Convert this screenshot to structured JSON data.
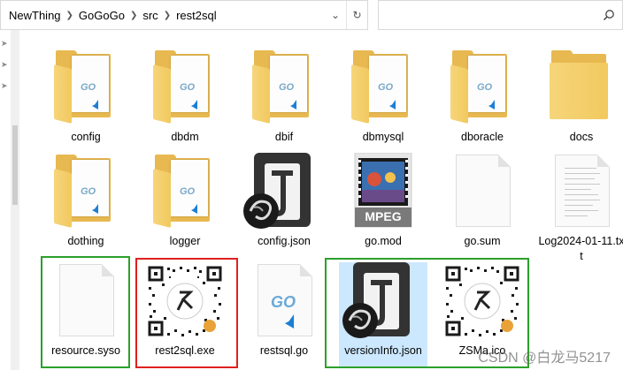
{
  "address_bar": {
    "crumbs": [
      "NewThing",
      "GoGoGo",
      "src",
      "rest2sql"
    ],
    "dropdown_icon": "chevron-down-icon",
    "refresh_icon": "refresh-icon"
  },
  "search": {
    "placeholder": "",
    "icon": "search-icon"
  },
  "files": [
    {
      "name": "config",
      "kind": "folder-go"
    },
    {
      "name": "dbdm",
      "kind": "folder-go"
    },
    {
      "name": "dbif",
      "kind": "folder-go"
    },
    {
      "name": "dbmysql",
      "kind": "folder-go"
    },
    {
      "name": "dboracle",
      "kind": "folder-go"
    },
    {
      "name": "docs",
      "kind": "folder"
    },
    {
      "name": "dothing",
      "kind": "folder-go"
    },
    {
      "name": "logger",
      "kind": "folder-go"
    },
    {
      "name": "config.json",
      "kind": "json-app"
    },
    {
      "name": "go.mod",
      "kind": "mpeg"
    },
    {
      "name": "go.sum",
      "kind": "blank-file"
    },
    {
      "name": "Log2024-01-11.txt",
      "kind": "text-file"
    },
    {
      "name": "resource.syso",
      "kind": "blank-file"
    },
    {
      "name": "rest2sql.exe",
      "kind": "qr"
    },
    {
      "name": "restsql.go",
      "kind": "go-file"
    },
    {
      "name": "versionInfo.json",
      "kind": "json-app"
    },
    {
      "name": "ZSMa.ico",
      "kind": "qr"
    }
  ],
  "icon_text": {
    "mpeg": "MPEG",
    "go": "GO"
  },
  "highlights": [
    {
      "color": "#2ca02c",
      "covers": [
        "resource.syso"
      ]
    },
    {
      "color": "#e02020",
      "covers": [
        "rest2sql.exe"
      ]
    },
    {
      "color": "#2ca02c",
      "covers": [
        "versionInfo.json",
        "ZSMa.ico"
      ]
    }
  ],
  "watermark": "CSDN @白龙马5217",
  "colors": {
    "selection": "#cce8ff",
    "folder": "#e8b950",
    "highlight_green": "#2ca02c",
    "highlight_red": "#e02020"
  }
}
